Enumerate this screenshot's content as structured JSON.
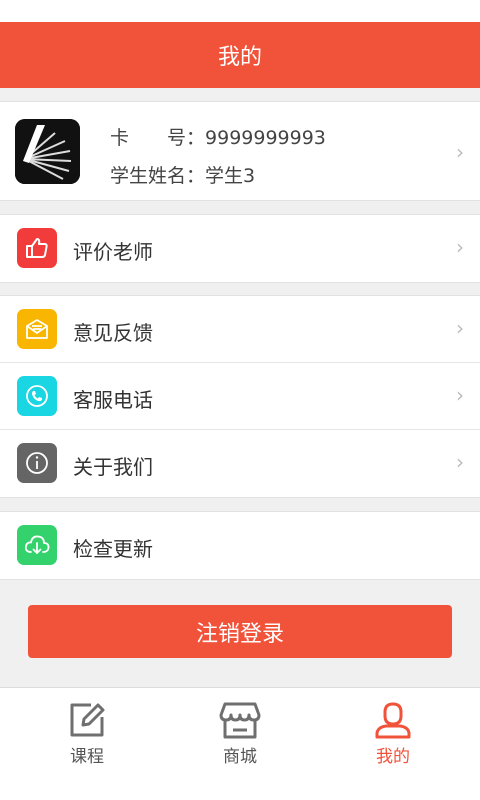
{
  "header": {
    "title": "我的"
  },
  "profile": {
    "card_label": "卡　　号：",
    "card_number": "9999999993",
    "name_label": "学生姓名：",
    "name_value": "学生3"
  },
  "menu": {
    "rate_teacher": "评价老师",
    "feedback": "意见反馈",
    "service_phone": "客服电话",
    "about_us": "关于我们",
    "check_update": "检查更新"
  },
  "logout_label": "注销登录",
  "tabs": [
    {
      "label": "课程",
      "icon": "edit-icon"
    },
    {
      "label": "商城",
      "icon": "store-icon"
    },
    {
      "label": "我的",
      "icon": "person-icon",
      "active": true
    }
  ],
  "colors": {
    "accent": "#f0533a",
    "rate_icon_bg": "#f23c3c",
    "feedback_icon_bg": "#f9b600",
    "phone_icon_bg": "#1ad5e2",
    "about_icon_bg": "#656565",
    "update_icon_bg": "#33d26c"
  }
}
